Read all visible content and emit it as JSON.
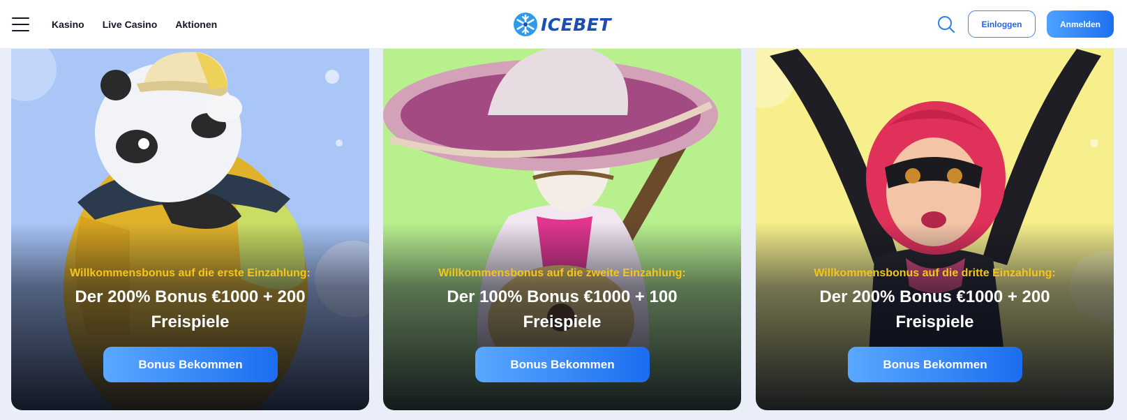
{
  "header": {
    "nav": [
      "Kasino",
      "Live Casino",
      "Aktionen"
    ],
    "logo_text": "ICEBET",
    "login_label": "Einloggen",
    "signup_label": "Anmelden",
    "icons": {
      "menu": "hamburger-menu-icon",
      "search": "search-icon",
      "logo": "snowflake-icon"
    }
  },
  "cards": [
    {
      "subtitle": "Willkommensbonus auf die erste Einzahlung:",
      "title": "Der 200% Bonus €1000 + 200 Freispiele",
      "button": "Bonus Bekommen",
      "background": "#a9c6f7"
    },
    {
      "subtitle": "Willkommensbonus auf die zweite Einzahlung:",
      "title": "Der 100% Bonus €1000 + 100 Freispiele",
      "button": "Bonus Bekommen",
      "background": "#b9f08e"
    },
    {
      "subtitle": "Willkommensbonus auf die dritte Einzahlung:",
      "title": "Der 200% Bonus €1000 + 200 Freispiele",
      "button": "Bonus Bekommen",
      "background": "#f6ef8c"
    }
  ],
  "colors": {
    "accent": "#2563eb",
    "subtitle_yellow": "#f5c518",
    "button_gradient_start": "#5aa8ff",
    "button_gradient_end": "#1c6df0"
  }
}
